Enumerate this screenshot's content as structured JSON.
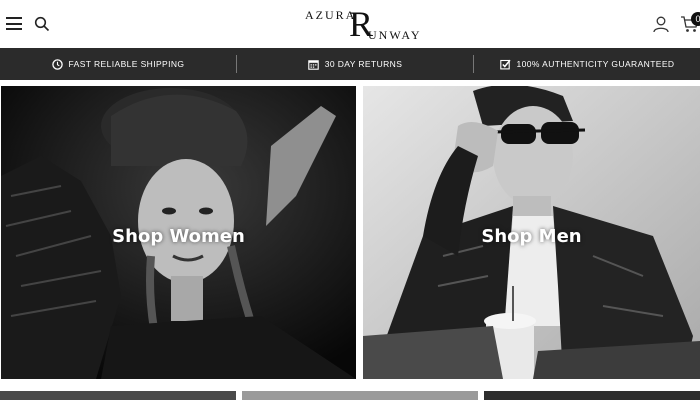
{
  "header": {
    "logo_top": "AZURA",
    "logo_initial": "R",
    "logo_bottom": "UNWAY",
    "cart_count": "0"
  },
  "promo": {
    "items": [
      {
        "icon": "clock-icon",
        "label": "FAST RELIABLE SHIPPING"
      },
      {
        "icon": "calendar-icon",
        "label": "30 DAY RETURNS"
      },
      {
        "icon": "checkbox-icon",
        "label": "100% AUTHENTICITY GUARANTEED"
      }
    ]
  },
  "panels": {
    "women_label": "Shop Women",
    "men_label": "Shop Men"
  },
  "colors": {
    "promo_bg": "#2b2b2b",
    "text_dark": "#111111"
  }
}
